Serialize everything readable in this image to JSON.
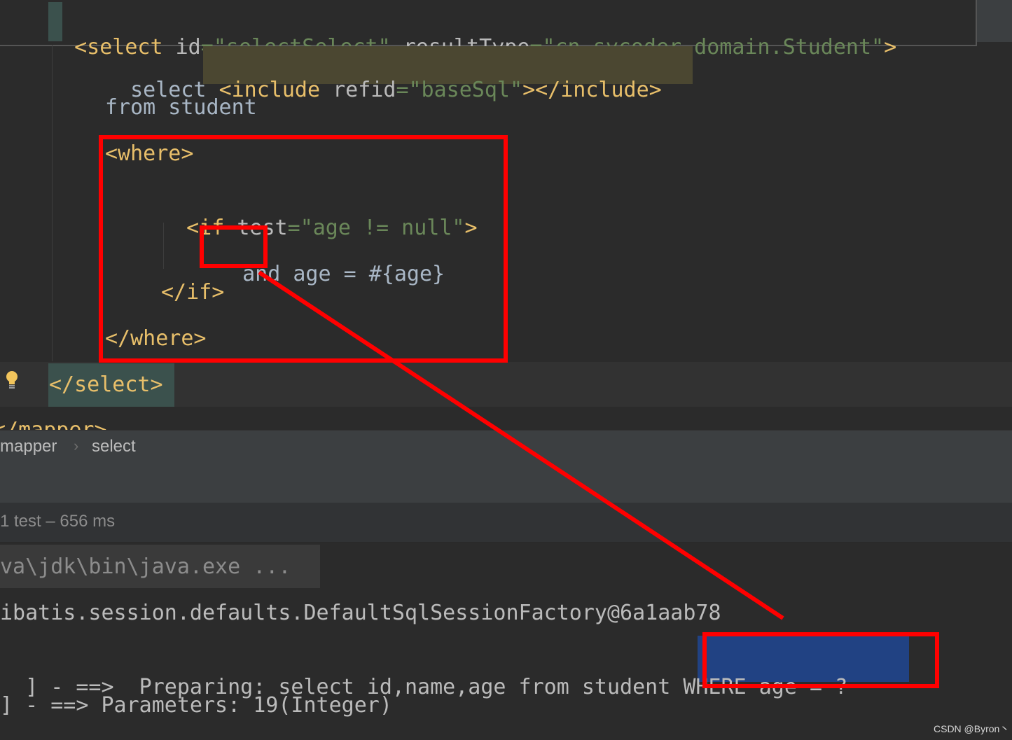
{
  "editor": {
    "line1": {
      "open": "<select",
      "attr1": "id",
      "eq1": "=",
      "val1": "\"selectSelect\"",
      "attr2": "resultType",
      "eq2": "=",
      "val2a": "\"cn.",
      "val2b": "sycoder",
      "val2c": ".domain.Student\"",
      "close": ">"
    },
    "line2": {
      "keyword": "select",
      "inc_open": "<include",
      "inc_attr": "refid",
      "inc_eq": "=",
      "inc_val": "\"baseSql\"",
      "inc_close": "></include>"
    },
    "line3": "from student",
    "line4": "<where>",
    "line5": {
      "open": "<if",
      "attr": "test",
      "eq": "=",
      "val": "\"age != null\"",
      "close": ">"
    },
    "line6": {
      "and": "and",
      "rest": " age = #{age}"
    },
    "line7": "</if>",
    "line8": "</where>",
    "line9": "</select>",
    "line10": "</mapper>"
  },
  "breadcrumb": {
    "item1": "mapper",
    "sep": "›",
    "item2": "select"
  },
  "run": {
    "summary": "1 test – 656 ms"
  },
  "console": {
    "line1": "va\\jdk\\bin\\java.exe ...",
    "line2": "ibatis.session.defaults.DefaultSqlSessionFactory@6a1aab78",
    "line3_pre": "] - ==>  Preparing: select id,name,age from student",
    "line3_hl": " WHERE age = ?",
    "line4": "] - ==> Parameters: 19(Integer)"
  },
  "watermark": "CSDN @Byron丶",
  "colors": {
    "background": "#2b2b2b",
    "tag": "#e8bf6a",
    "string": "#6a8759",
    "annotation": "#ff0000",
    "highlight": "#214283"
  }
}
